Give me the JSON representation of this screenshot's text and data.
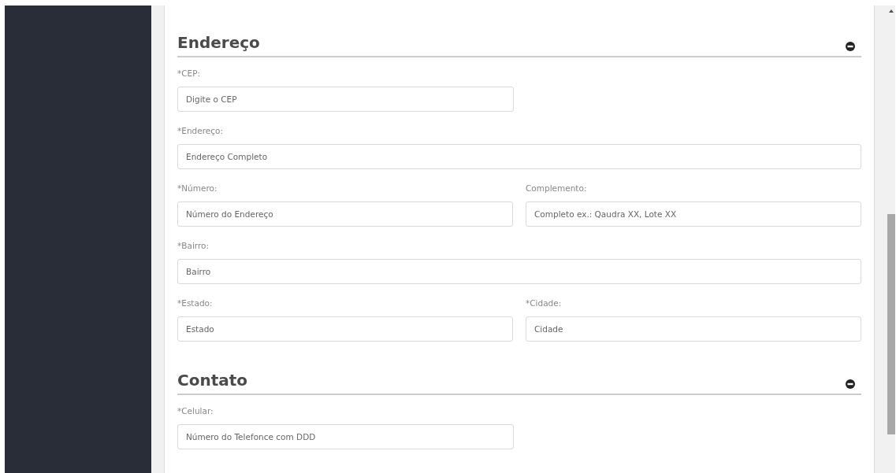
{
  "sections": [
    {
      "title": "Endereço",
      "expanded": true,
      "rows": [
        [
          {
            "kind": "half",
            "label": "*CEP:",
            "placeholder": "Digite o CEP"
          }
        ],
        [
          {
            "kind": "full",
            "label": "*Endereço:",
            "placeholder": "Endereço Completo"
          }
        ],
        [
          {
            "kind": "half",
            "label": "*Número:",
            "placeholder": "Número do Endereço"
          },
          {
            "kind": "half",
            "label": "Complemento:",
            "placeholder": "Completo ex.: Qaudra XX, Lote XX"
          }
        ],
        [
          {
            "kind": "full",
            "label": "*Bairro:",
            "placeholder": "Bairro"
          }
        ],
        [
          {
            "kind": "half",
            "label": "*Estado:",
            "placeholder": "Estado"
          },
          {
            "kind": "half",
            "label": "*Cidade:",
            "placeholder": "Cidade"
          }
        ]
      ]
    },
    {
      "title": "Contato",
      "expanded": true,
      "rows": [
        [
          {
            "kind": "half",
            "label": "*Celular:",
            "placeholder": "Número do Telefonce com DDD"
          }
        ]
      ]
    }
  ]
}
